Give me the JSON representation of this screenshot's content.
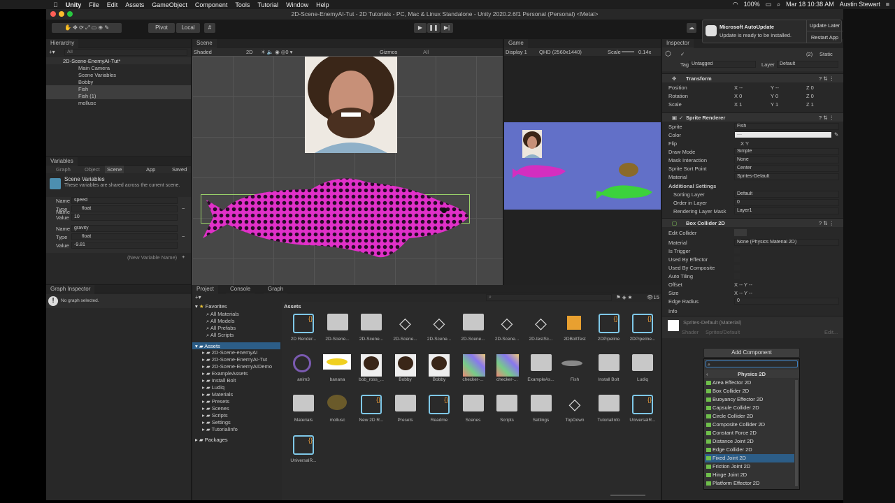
{
  "menubar": {
    "app": "Unity",
    "items": [
      "File",
      "Edit",
      "Assets",
      "GameObject",
      "Component",
      "Tools",
      "Tutorial",
      "Window",
      "Help"
    ],
    "battery": "100%",
    "datetime": "Mar 18  10:38 AM",
    "user": "Austin Stewart"
  },
  "window": {
    "title": "2D-Scene-EnemyAI-Tut - 2D Tutorials - PC, Mac & Linux Standalone - Unity 2020.2.6f1 Personal (Personal) <Metal>"
  },
  "toolbar": {
    "pivot": "Pivot",
    "local": "Local"
  },
  "notification": {
    "title": "Microsoft AutoUpdate",
    "message": "Update is ready to be installed.",
    "update_later": "Update Later",
    "restart_app": "Restart App"
  },
  "hierarchy": {
    "tab": "Hierarchy",
    "search_placeholder": "All",
    "scene": "2D-Scene-EnemyAI-Tut*",
    "items": [
      "Main Camera",
      "Scene Variables",
      "Bobby",
      "Fish",
      "Fish (1)",
      "mollusc"
    ]
  },
  "variables": {
    "tab": "Variables",
    "tabs": [
      "Graph",
      "Object",
      "Scene",
      "App",
      "Saved"
    ],
    "heading": "Scene Variables",
    "description": "These variables are shared across the current scene.",
    "labels": {
      "name": "Name",
      "type": "Type",
      "value": "Value"
    },
    "vars": [
      {
        "name": "speed",
        "type": "float",
        "value": "10"
      },
      {
        "name": "gravity",
        "type": "float",
        "value": "-9.81"
      }
    ],
    "new_placeholder": "(New Variable Name)"
  },
  "scene": {
    "tab": "Scene",
    "shading": "Shaded",
    "mode": "2D",
    "gizmos": "Gizmos",
    "search_placeholder": "All"
  },
  "game": {
    "tab": "Game",
    "display": "Display 1",
    "resolution": "QHD (2560x1440)",
    "scale_label": "Scale",
    "scale_value": "0.14x"
  },
  "inspector": {
    "tab": "Inspector",
    "static": "Static",
    "tag_label": "Tag",
    "tag": "Untagged",
    "layer_label": "Layer",
    "layer": "Default",
    "layer_num": "(2)",
    "transform": {
      "title": "Transform",
      "rows": [
        {
          "label": "Position",
          "x": "--",
          "y": "--",
          "z": "0"
        },
        {
          "label": "Rotation",
          "x": "0",
          "y": "0",
          "z": "0"
        },
        {
          "label": "Scale",
          "x": "1",
          "y": "1",
          "z": "1"
        }
      ]
    },
    "sprite_renderer": {
      "title": "Sprite Renderer",
      "rows": [
        {
          "label": "Sprite",
          "value": "Fish"
        },
        {
          "label": "Color",
          "value": "—"
        },
        {
          "label": "Flip",
          "value": "X    Y"
        },
        {
          "label": "Draw Mode",
          "value": "Simple"
        },
        {
          "label": "Mask Interaction",
          "value": "None"
        },
        {
          "label": "Sprite Sort Point",
          "value": "Center"
        },
        {
          "label": "Material",
          "value": "Sprites-Default"
        }
      ],
      "additional": "Additional Settings",
      "extra_rows": [
        {
          "label": "Sorting Layer",
          "value": "Default"
        },
        {
          "label": "Order in Layer",
          "value": "0"
        },
        {
          "label": "Rendering Layer Mask",
          "value": "Layer1"
        }
      ]
    },
    "box_collider": {
      "title": "Box Collider 2D",
      "rows": [
        {
          "label": "Edit Collider",
          "value": ""
        },
        {
          "label": "Material",
          "value": "None (Physics Material 2D)"
        },
        {
          "label": "Is Trigger",
          "value": ""
        },
        {
          "label": "Used By Effector",
          "value": ""
        },
        {
          "label": "Used By Composite",
          "value": ""
        },
        {
          "label": "Auto Tiling",
          "value": ""
        },
        {
          "label": "Offset",
          "value": "X --    Y --"
        },
        {
          "label": "Size",
          "value": "X --    Y --"
        },
        {
          "label": "Edge Radius",
          "value": "0"
        }
      ],
      "info": "Info"
    },
    "material": {
      "name": "Sprites-Default (Material)",
      "shader_label": "Shader",
      "shader": "Sprites/Default",
      "edit": "Edit..."
    },
    "add_component": "Add Component",
    "dropdown": {
      "title": "Physics 2D",
      "items": [
        "Area Effector 2D",
        "Box Collider 2D",
        "Buoyancy Effector 2D",
        "Capsule Collider 2D",
        "Circle Collider 2D",
        "Composite Collider 2D",
        "Constant Force 2D",
        "Distance Joint 2D",
        "Edge Collider 2D",
        "Fixed Joint 2D",
        "Friction Joint 2D",
        "Hinge Joint 2D",
        "Platform Effector 2D"
      ],
      "selected": "Fixed Joint 2D"
    }
  },
  "graph_inspector": {
    "tab": "Graph Inspector",
    "message": "No graph selected."
  },
  "project": {
    "tabs": [
      "Project",
      "Console",
      "Graph"
    ],
    "favorites": "Favorites",
    "fav_items": [
      "All Materials",
      "All Models",
      "All Prefabs",
      "All Scripts"
    ],
    "assets_root": "Assets",
    "tree": [
      "2D-Scene-enemyAI",
      "2D-Scene-EnemyAI-Tut",
      "2D-Scene-EnemyAIDemo",
      "ExampleAssets",
      "Install Bolt",
      "Ludiq",
      "Materials",
      "Presets",
      "Scenes",
      "Scripts",
      "Settings",
      "TutorialInfo"
    ],
    "packages": "Packages",
    "breadcrumb": "Assets",
    "count": "15",
    "assets": [
      [
        "2D Render...",
        "2D-Scene...",
        "2D-Scene...",
        "2D-Scene...",
        "2D-Scene...",
        "2D-Scene...",
        "2D-Scene...",
        "2D-testSc...",
        "2DBoltTest",
        "2DPipeline",
        "2DPipeline..."
      ],
      [
        "anim3",
        "banana",
        "bob_ross_...",
        "Bobby",
        "Bobby",
        "checker-...",
        "checker-...",
        "ExampleAs...",
        "Fish",
        "Install Bolt",
        "Ludiq"
      ],
      [
        "Materials",
        "mollusc",
        "New 2D R...",
        "Presets",
        "Readme",
        "Scenes",
        "Scripts",
        "Settings",
        "TopDown",
        "TutorialInfo",
        "UniversalR..."
      ],
      [
        "UniversalR..."
      ]
    ]
  },
  "colors": {
    "accent": "#2c5d87",
    "fish": "#e030c8",
    "game_bg": "#6270c8"
  }
}
